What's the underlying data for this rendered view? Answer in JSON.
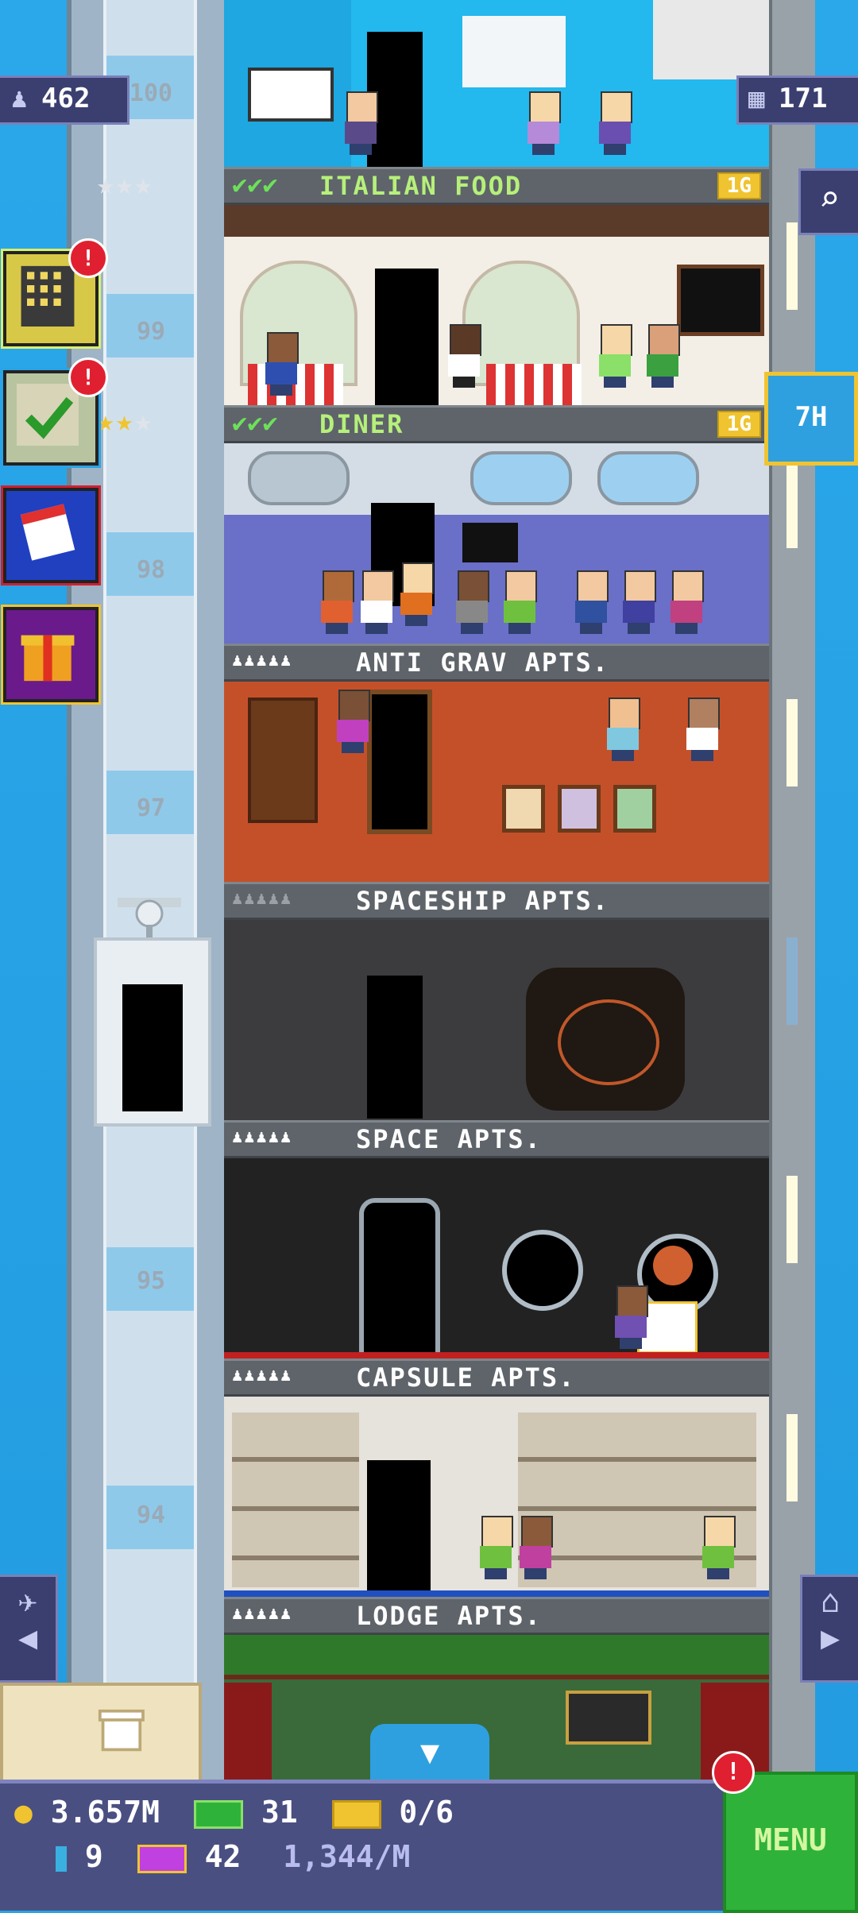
{
  "hud": {
    "population": "462",
    "floors": "171",
    "timer": "7H"
  },
  "floor_numbers": [
    "100",
    "99",
    "98",
    "97",
    "95",
    "94"
  ],
  "floors": [
    {
      "name": "ITALIAN FOOD",
      "type": "business",
      "checks": "✔✔✔",
      "badge": "1G"
    },
    {
      "name": "DINER",
      "type": "business",
      "checks": "✔✔✔",
      "badge": "1G"
    },
    {
      "name": "ANTI GRAV APTS.",
      "type": "residential"
    },
    {
      "name": "SPACESHIP APTS.",
      "type": "residential"
    },
    {
      "name": "SPACE APTS.",
      "type": "residential"
    },
    {
      "name": "CAPSULE APTS.",
      "type": "residential"
    },
    {
      "name": "LODGE APTS.",
      "type": "residential"
    }
  ],
  "side_alerts": {
    "buildings": "!",
    "missions": "!"
  },
  "bottom": {
    "coins": "3.657M",
    "bux": "31",
    "tickets": "0/6",
    "keys": "9",
    "vip": "42",
    "rate": "1,344/M",
    "menu": "MENU",
    "menu_alert": "!"
  },
  "colors": {
    "sky": "#2aa3e6",
    "hud_panel": "#4a4f82",
    "menu_green": "#2fb23a",
    "alert_red": "#e02030",
    "gold": "#f0c430"
  }
}
